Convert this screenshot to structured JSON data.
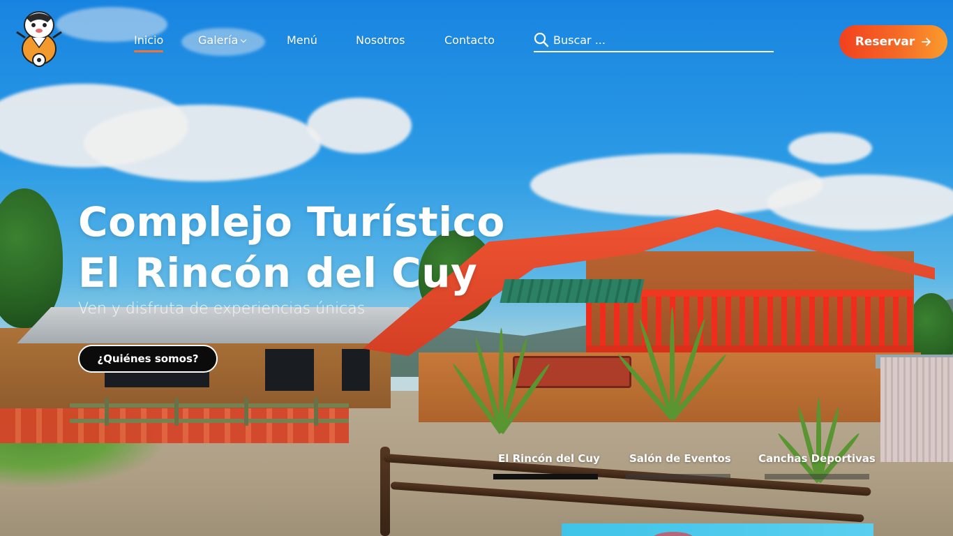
{
  "brand": {
    "logo_icon": "guinea-pig-mascot-icon"
  },
  "nav": {
    "items": [
      {
        "label": "Inicio",
        "active": true
      },
      {
        "label": "Galería",
        "has_dropdown": true
      },
      {
        "label": "Menú"
      },
      {
        "label": "Nosotros"
      },
      {
        "label": "Contacto"
      }
    ]
  },
  "search": {
    "placeholder": "Buscar ...",
    "value": "",
    "icon": "search-icon"
  },
  "header": {
    "cta_label": "Reservar",
    "cta_icon": "arrow-right-icon"
  },
  "hero": {
    "title_line1": "Complejo Turístico",
    "title_line2": "El Rincón del Cuy",
    "subtitle": "Ven y disfruta de experiencias únicas",
    "button_label": "¿Quiénes somos?"
  },
  "slider": {
    "tabs": [
      {
        "label": "El Rincón del Cuy",
        "active": true
      },
      {
        "label": "Salón de Eventos",
        "active": false
      },
      {
        "label": "Canchas Deportivas",
        "active": false
      }
    ]
  },
  "colors": {
    "accent": "#f0733a",
    "cta_start": "#f2401e",
    "cta_end": "#fa9c2d",
    "dark_button": "#0b0b0b"
  }
}
